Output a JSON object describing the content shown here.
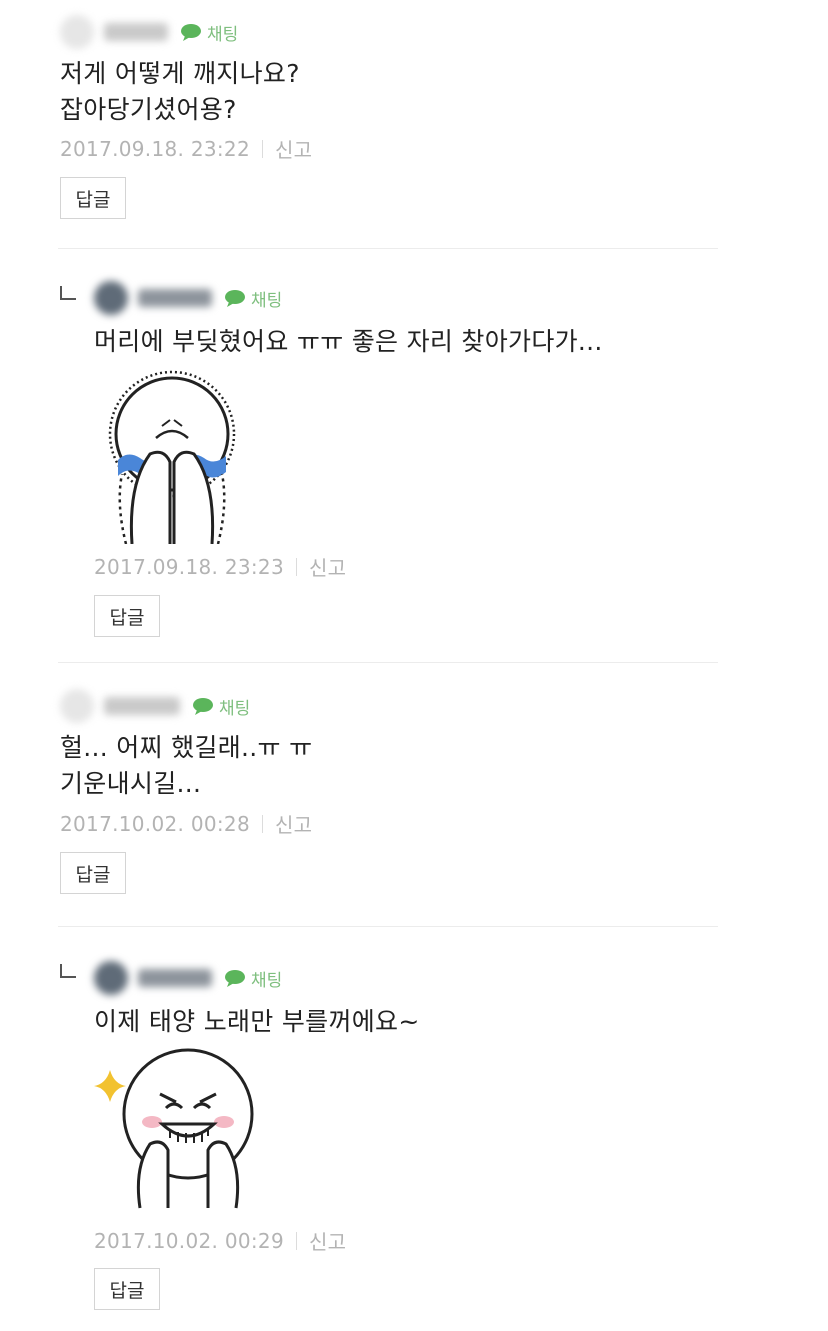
{
  "comments": [
    {
      "chat_label": "채팅",
      "lines": [
        "저게 어떻게 깨지나요?",
        "잡아당기셨어용?"
      ],
      "timestamp": "2017.09.18. 23:22",
      "report_label": "신고",
      "reply_label": "답글"
    },
    {
      "chat_label": "채팅",
      "lines": [
        "머리에 부딪혔어요 ㅠㅠ 좋은 자리 찾아가다가..."
      ],
      "sticker": "crying-face-sticker",
      "timestamp": "2017.09.18. 23:23",
      "report_label": "신고",
      "reply_label": "답글"
    },
    {
      "chat_label": "채팅",
      "lines": [
        "헐... 어찌 했길래..ㅠ ㅠ",
        "기운내시길..."
      ],
      "timestamp": "2017.10.02. 00:28",
      "report_label": "신고",
      "reply_label": "답글"
    },
    {
      "chat_label": "채팅",
      "lines": [
        "이제 태양 노래만 부를꺼에요~"
      ],
      "sticker": "grinning-face-sticker",
      "timestamp": "2017.10.02. 00:29",
      "report_label": "신고",
      "reply_label": "답글"
    }
  ],
  "colors": {
    "chat_green": "#7fbf7f",
    "meta_gray": "#b3b3b3",
    "tear_blue": "#4a86d8",
    "blush_pink": "#f4b8c4",
    "sparkle_yellow": "#f2c230"
  },
  "icons": [
    "speech-bubble-icon",
    "reply-arrow-icon",
    "sparkle-icon"
  ]
}
